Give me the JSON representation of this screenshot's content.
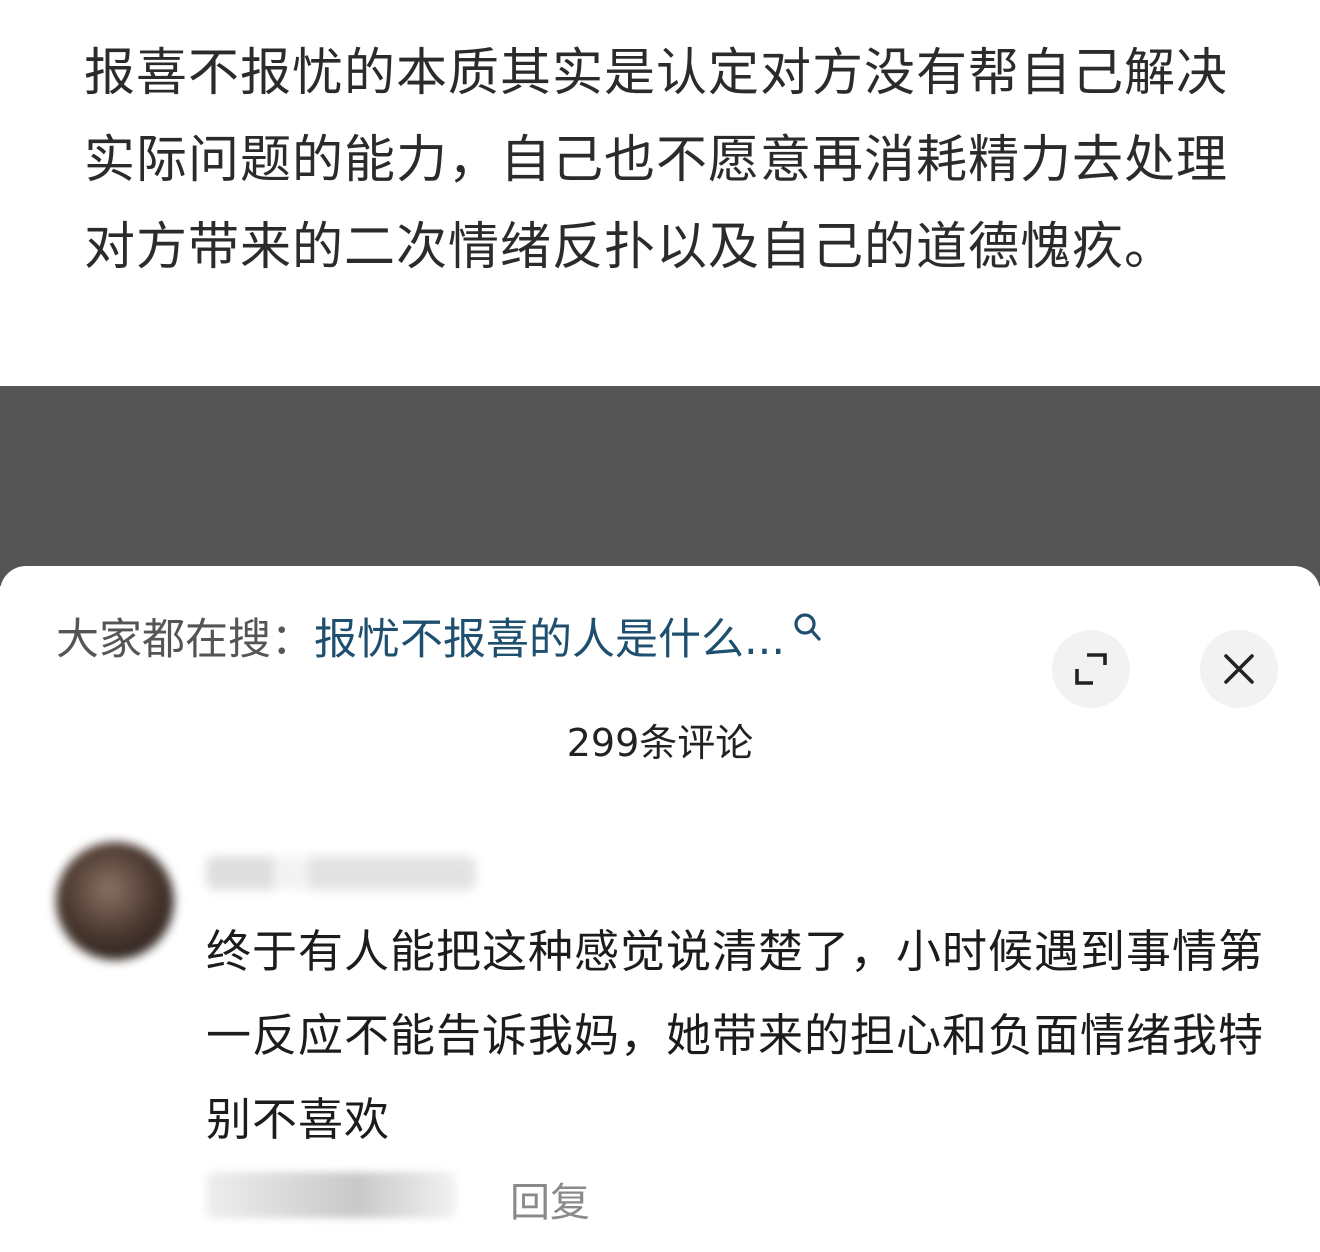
{
  "article": {
    "text": "报喜不报忧的本质其实是认定对方没有帮自己解决实际问题的能力，自己也不愿意再消耗精力去处理对方带来的二次情绪反扑以及自己的道德愧疚。"
  },
  "comment_panel": {
    "hot_search_label": "大家都在搜：",
    "hot_search_query": "报忧不报喜的人是什么...",
    "comment_count": "299条评论",
    "icons": {
      "search": "search-icon",
      "expand": "expand-icon",
      "close": "close-icon"
    }
  },
  "comments": [
    {
      "text": "终于有人能把这种感觉说清楚了，小时候遇到事情第一反应不能告诉我妈，她带来的担心和负面情绪我特别不喜欢",
      "reply_label": "回复"
    }
  ]
}
